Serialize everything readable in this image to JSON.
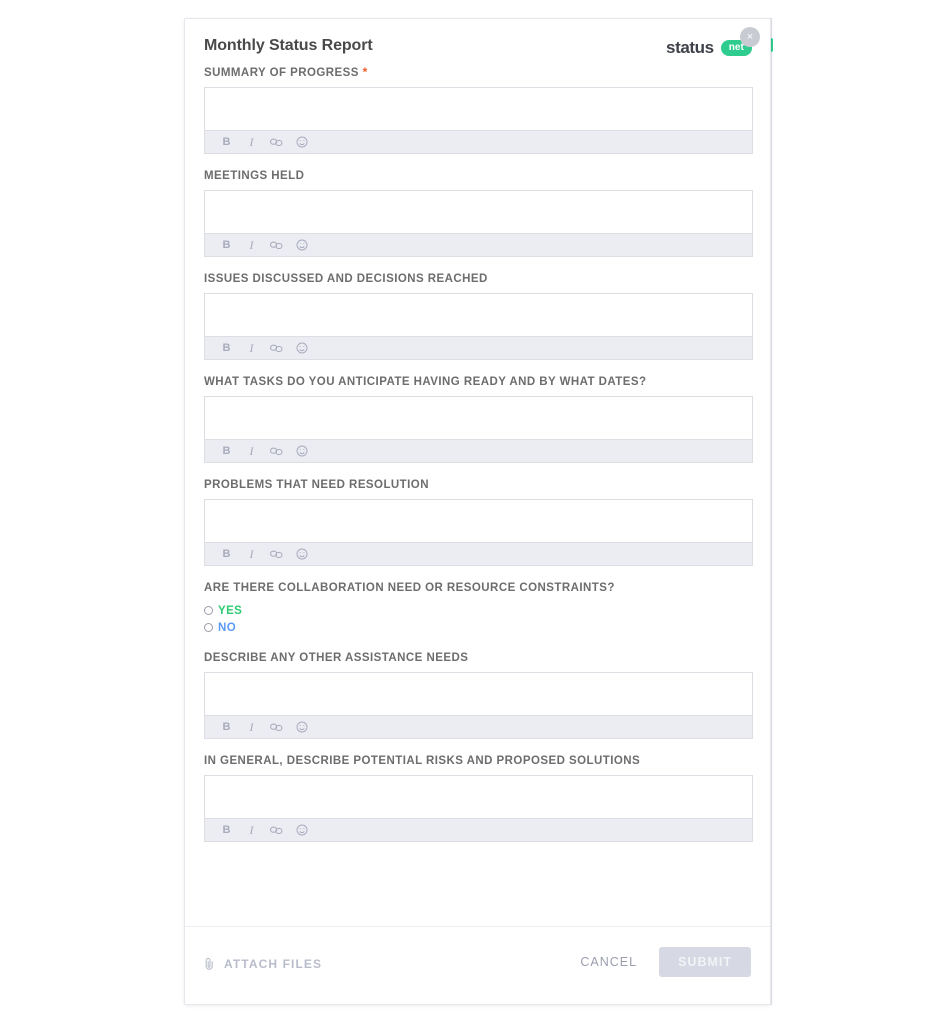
{
  "modal": {
    "title": "Monthly Status Report",
    "close_label": "×",
    "brand": {
      "name": "status",
      "pill": "net"
    }
  },
  "fields": [
    {
      "label": "SUMMARY OF PROGRESS",
      "required": true,
      "required_mark": "*",
      "value": "",
      "type": "rich-text"
    },
    {
      "label": "MEETINGS HELD",
      "required": false,
      "value": "",
      "type": "rich-text"
    },
    {
      "label": "ISSUES DISCUSSED AND DECISIONS REACHED",
      "required": false,
      "value": "",
      "type": "rich-text"
    },
    {
      "label": "WHAT TASKS DO YOU ANTICIPATE HAVING READY AND BY WHAT DATES?",
      "required": false,
      "value": "",
      "type": "rich-text"
    },
    {
      "label": "PROBLEMS THAT NEED RESOLUTION",
      "required": false,
      "value": "",
      "type": "rich-text"
    },
    {
      "label": "ARE THERE COLLABORATION NEED OR RESOURCE CONSTRAINTS?",
      "required": false,
      "type": "radio",
      "options": [
        {
          "label": "YES",
          "selected": false,
          "color": "#2ecc71"
        },
        {
          "label": "NO",
          "selected": false,
          "color": "#5b9bf5"
        }
      ]
    },
    {
      "label": "DESCRIBE ANY OTHER ASSISTANCE NEEDS",
      "required": false,
      "value": "",
      "type": "rich-text"
    },
    {
      "label": "IN GENERAL, DESCRIBE POTENTIAL RISKS AND PROPOSED SOLUTIONS",
      "required": false,
      "value": "",
      "type": "rich-text"
    }
  ],
  "toolbar": {
    "bold": "B",
    "italic": "I",
    "link_icon": "link-icon",
    "emoji_icon": "smiley-icon"
  },
  "footer": {
    "attach_label": "ATTACH FILES",
    "attach_icon": "paperclip-icon",
    "cancel_label": "CANCEL",
    "submit_label": "SUBMIT",
    "submit_disabled": true
  },
  "colors": {
    "brand_green": "#2ecc8f",
    "required_star": "#f05b28",
    "yes_green": "#2ecc71",
    "no_blue": "#5b9bf5",
    "toolbar_bg": "#ecedf3",
    "submit_disabled_bg": "#d6d8e3",
    "label_gray": "#6d6d6d"
  }
}
